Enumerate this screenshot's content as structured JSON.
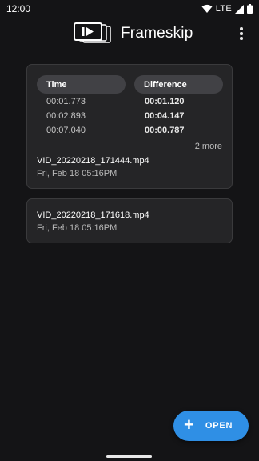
{
  "status_bar": {
    "time": "12:00",
    "network": "LTE",
    "icons": [
      "wifi-icon",
      "cell-signal-icon",
      "battery-icon"
    ]
  },
  "app_bar": {
    "title": "Frameskip",
    "logo_icon": "frameskip-logo-icon",
    "overflow_icon": "more-vert-icon"
  },
  "recordings": [
    {
      "columns": {
        "time": "Time",
        "difference": "Difference"
      },
      "rows": [
        {
          "time": "00:01.773",
          "difference": "00:01.120"
        },
        {
          "time": "00:02.893",
          "difference": "00:04.147"
        },
        {
          "time": "00:07.040",
          "difference": "00:00.787"
        }
      ],
      "more_label": "2 more",
      "file_name": "VID_20220218_171444.mp4",
      "date": "Fri, Feb 18 05:16PM"
    },
    {
      "file_name": "VID_20220218_171618.mp4",
      "date": "Fri, Feb 18 05:16PM"
    }
  ],
  "fab": {
    "label": "OPEN",
    "icon": "plus-icon"
  },
  "colors": {
    "background": "#141416",
    "card": "#252527",
    "column_header": "#414145",
    "fab": "#2f8fe5"
  }
}
